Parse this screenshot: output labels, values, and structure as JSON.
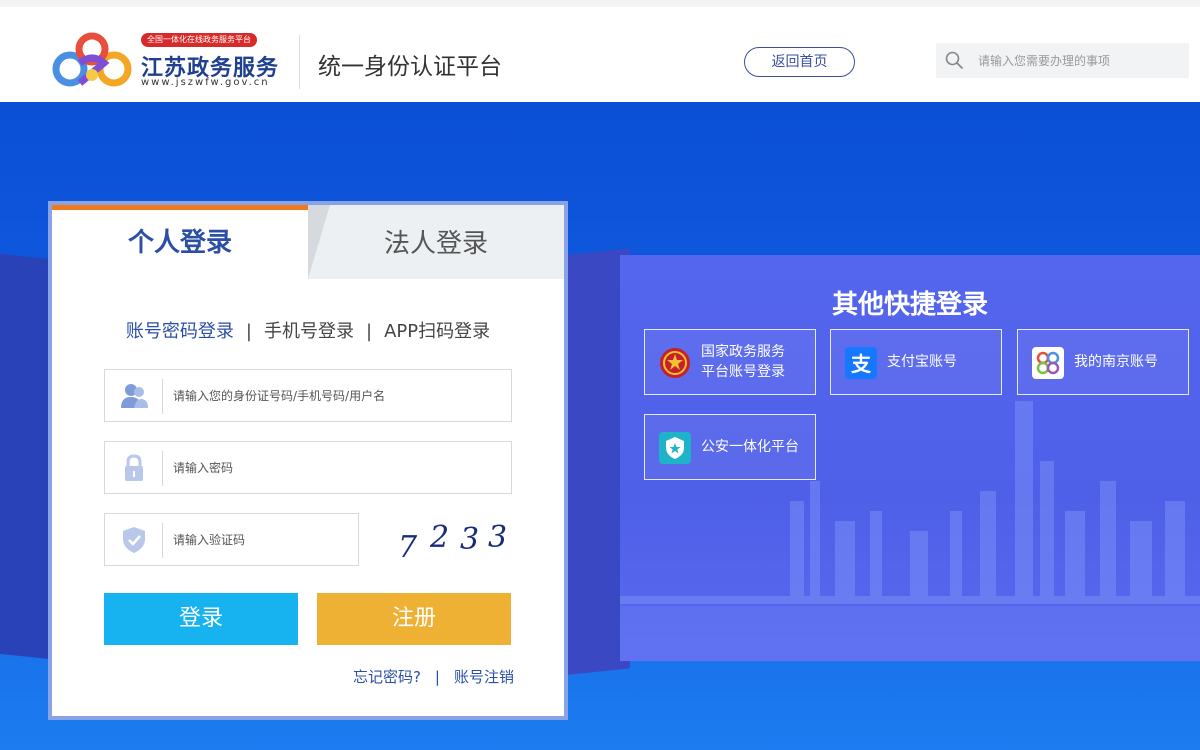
{
  "header": {
    "logo_badge": "全国一体化在线政务服务平台",
    "logo_title": "江苏政务服务",
    "logo_url": "www.jszwfw.gov.cn",
    "platform_title": "统一身份认证平台",
    "home_button": "返回首页",
    "search_placeholder": "请输入您需要办理的事项"
  },
  "login": {
    "tabs": [
      {
        "label": "个人登录",
        "active": true
      },
      {
        "label": "法人登录",
        "active": false
      }
    ],
    "methods": [
      {
        "label": "账号密码登录",
        "active": true
      },
      {
        "label": "手机号登录",
        "active": false
      },
      {
        "label": "APP扫码登录",
        "active": false
      }
    ],
    "method_separator": "|",
    "username_placeholder": "请输入您的身份证号码/手机号码/用户名",
    "password_placeholder": "请输入密码",
    "captcha_placeholder": "请输入验证码",
    "captcha_digits": [
      "7",
      "2",
      "3",
      "3"
    ],
    "login_button": "登录",
    "register_button": "注册",
    "forgot_password": "忘记密码?",
    "link_separator": "|",
    "account_cancel": "账号注销"
  },
  "quick_login": {
    "title": "其他快捷登录",
    "options": [
      {
        "label_line1": "国家政务服务",
        "label_line2": "平台账号登录",
        "icon": "national-emblem-icon"
      },
      {
        "label_line1": "支付宝账号",
        "label_line2": "",
        "icon": "alipay-icon"
      },
      {
        "label_line1": "我的南京账号",
        "label_line2": "",
        "icon": "my-nanjing-icon"
      },
      {
        "label_line1": "公安一体化平台",
        "label_line2": "",
        "icon": "police-badge-icon"
      }
    ]
  },
  "colors": {
    "primary_blue": "#2c4fa6",
    "login_button": "#17b3f0",
    "register_button": "#efb134",
    "tab_accent": "#f07a1a",
    "hero_blue": "#0a4fd6",
    "quick_panel": "#5566ee"
  }
}
